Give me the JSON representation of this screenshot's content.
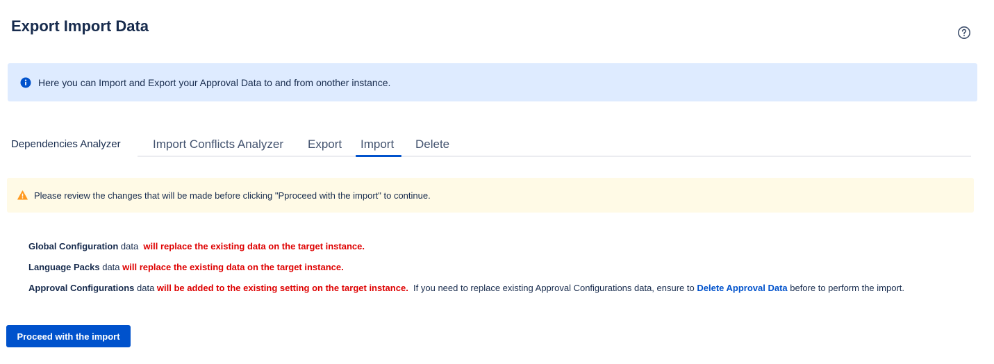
{
  "header": {
    "title": "Export Import Data",
    "help_icon": "question-circle-icon"
  },
  "info_banner": {
    "icon": "info-circle-icon",
    "text": "Here you can Import and Export your Approval Data to and from onother instance."
  },
  "tabs": [
    {
      "label": "Dependencies Analyzer",
      "active": false
    },
    {
      "label": "Import Conflicts Analyzer",
      "active": false
    },
    {
      "label": "Export",
      "active": false
    },
    {
      "label": "Import",
      "active": true
    },
    {
      "label": "Delete",
      "active": false
    }
  ],
  "warning_banner": {
    "icon": "warning-triangle-icon",
    "text": "Please review the changes that will be made before clicking \"Pproceed with the import\" to continue."
  },
  "changes": [
    {
      "name": "Global Configuration",
      "suffix": " data  ",
      "effect": "will replace the existing data on the target instance."
    },
    {
      "name": "Language Packs",
      "suffix": " data ",
      "effect": "will replace the existing data on the target instance."
    },
    {
      "name": "Approval Configurations",
      "suffix": " data ",
      "effect": "will be added to the existing setting on the target instance.",
      "note_before": "  If you need to replace existing Approval Configurations data, ensure to ",
      "link": "Delete Approval Data",
      "note_after": " before to perform the import."
    }
  ],
  "actions": {
    "proceed_label": "Proceed with the import"
  },
  "colors": {
    "primary": "#0052cc",
    "info_bg": "#deebff",
    "warning_bg": "#fffae6",
    "warning_icon": "#ff991f",
    "danger_text": "#de0000"
  }
}
